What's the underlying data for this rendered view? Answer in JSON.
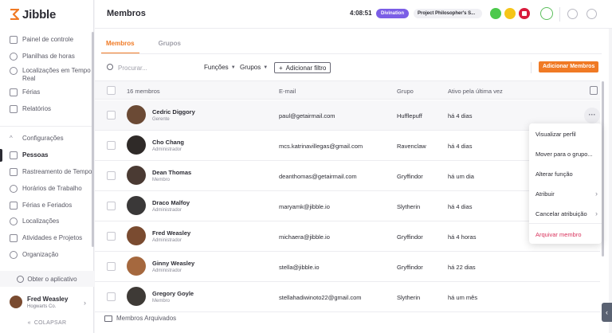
{
  "app": {
    "name": "Jibble",
    "brand_color": "#f07a25"
  },
  "sidebar": {
    "items": [
      {
        "label": "Painel de controle",
        "icon": "dashboard-icon"
      },
      {
        "label": "Planilhas de horas",
        "icon": "clock-icon"
      },
      {
        "label": "Localizações em Tempo Real",
        "icon": "location-pin-icon"
      },
      {
        "label": "Férias",
        "icon": "suitcase-icon"
      },
      {
        "label": "Relatórios",
        "icon": "report-icon"
      }
    ],
    "settings_header": "Configurações",
    "settings_items": [
      {
        "label": "Pessoas",
        "icon": "people-icon",
        "active": true
      },
      {
        "label": "Rastreamento de Tempo",
        "icon": "time-tracking-icon"
      },
      {
        "label": "Horários de Trabalho",
        "icon": "schedule-icon"
      },
      {
        "label": "Férias e Feriados",
        "icon": "calendar-icon"
      },
      {
        "label": "Localizações",
        "icon": "location-pin-icon"
      },
      {
        "label": "Atividades e Projetos",
        "icon": "tag-icon"
      },
      {
        "label": "Organização",
        "icon": "gear-icon"
      }
    ],
    "get_app": "Obter o aplicativo",
    "user": {
      "name": "Fred Weasley",
      "org": "Hogwarts Co."
    },
    "collapse": "COLAPSAR"
  },
  "header": {
    "title": "Membros",
    "timer": "4:08:51",
    "activity_badge": "Divination",
    "project": "Project Philosopher's S..."
  },
  "tabs": [
    {
      "label": "Membros",
      "active": true
    },
    {
      "label": "Grupos",
      "active": false
    }
  ],
  "toolbar": {
    "search_placeholder": "Procurar...",
    "filter_functions": "Funções",
    "filter_groups": "Grupos",
    "add_filter": "Adicionar filtro",
    "add_members": "Adicionar Membros"
  },
  "table": {
    "member_count": "16 membros",
    "columns": {
      "email": "E-mail",
      "group": "Grupo",
      "last_active": "Ativo pela última vez"
    },
    "rows": [
      {
        "name": "Cedric Diggory",
        "role": "Gerente",
        "email": "paul@getairmail.com",
        "group": "Hufflepuff",
        "last_active": "há 4 dias",
        "avatar_color": "#6b4a35"
      },
      {
        "name": "Cho Chang",
        "role": "Administrador",
        "email": "mcs.katrinavillegas@gmail.com",
        "group": "Ravenclaw",
        "last_active": "há 4 dias",
        "avatar_color": "#2f2a28"
      },
      {
        "name": "Dean Thomas",
        "role": "Membro",
        "email": "deanthomas@getairmail.com",
        "group": "Gryffindor",
        "last_active": "há um dia",
        "avatar_color": "#4a3a33"
      },
      {
        "name": "Draco Malfoy",
        "role": "Administrador",
        "email": "maryamk@jibble.io",
        "group": "Slytherin",
        "last_active": "há 4 dias",
        "avatar_color": "#3a3838"
      },
      {
        "name": "Fred Weasley",
        "role": "Administrador",
        "email": "michaera@jibble.io",
        "group": "Gryffindor",
        "last_active": "há 4 horas",
        "avatar_color": "#7a4b30"
      },
      {
        "name": "Ginny Weasley",
        "role": "Administrador",
        "email": "stella@jibble.io",
        "group": "Gryffindor",
        "last_active": "há 22 dias",
        "avatar_color": "#a5683e"
      },
      {
        "name": "Gregory Goyle",
        "role": "Membro",
        "email": "stellahadiwinoto22@gmail.com",
        "group": "Slytherin",
        "last_active": "há um mês",
        "avatar_color": "#3e3a36"
      }
    ]
  },
  "context_menu": {
    "items": [
      {
        "label": "Visualizar perfil",
        "submenu": false
      },
      {
        "label": "Mover para o grupo...",
        "submenu": false
      },
      {
        "label": "Alterar função",
        "submenu": false
      },
      {
        "label": "Atribuir",
        "submenu": true
      },
      {
        "label": "Cancelar atribuição",
        "submenu": true
      }
    ],
    "danger_item": "Arquivar membro"
  },
  "footer": {
    "archived": "Membros Arquivados"
  }
}
